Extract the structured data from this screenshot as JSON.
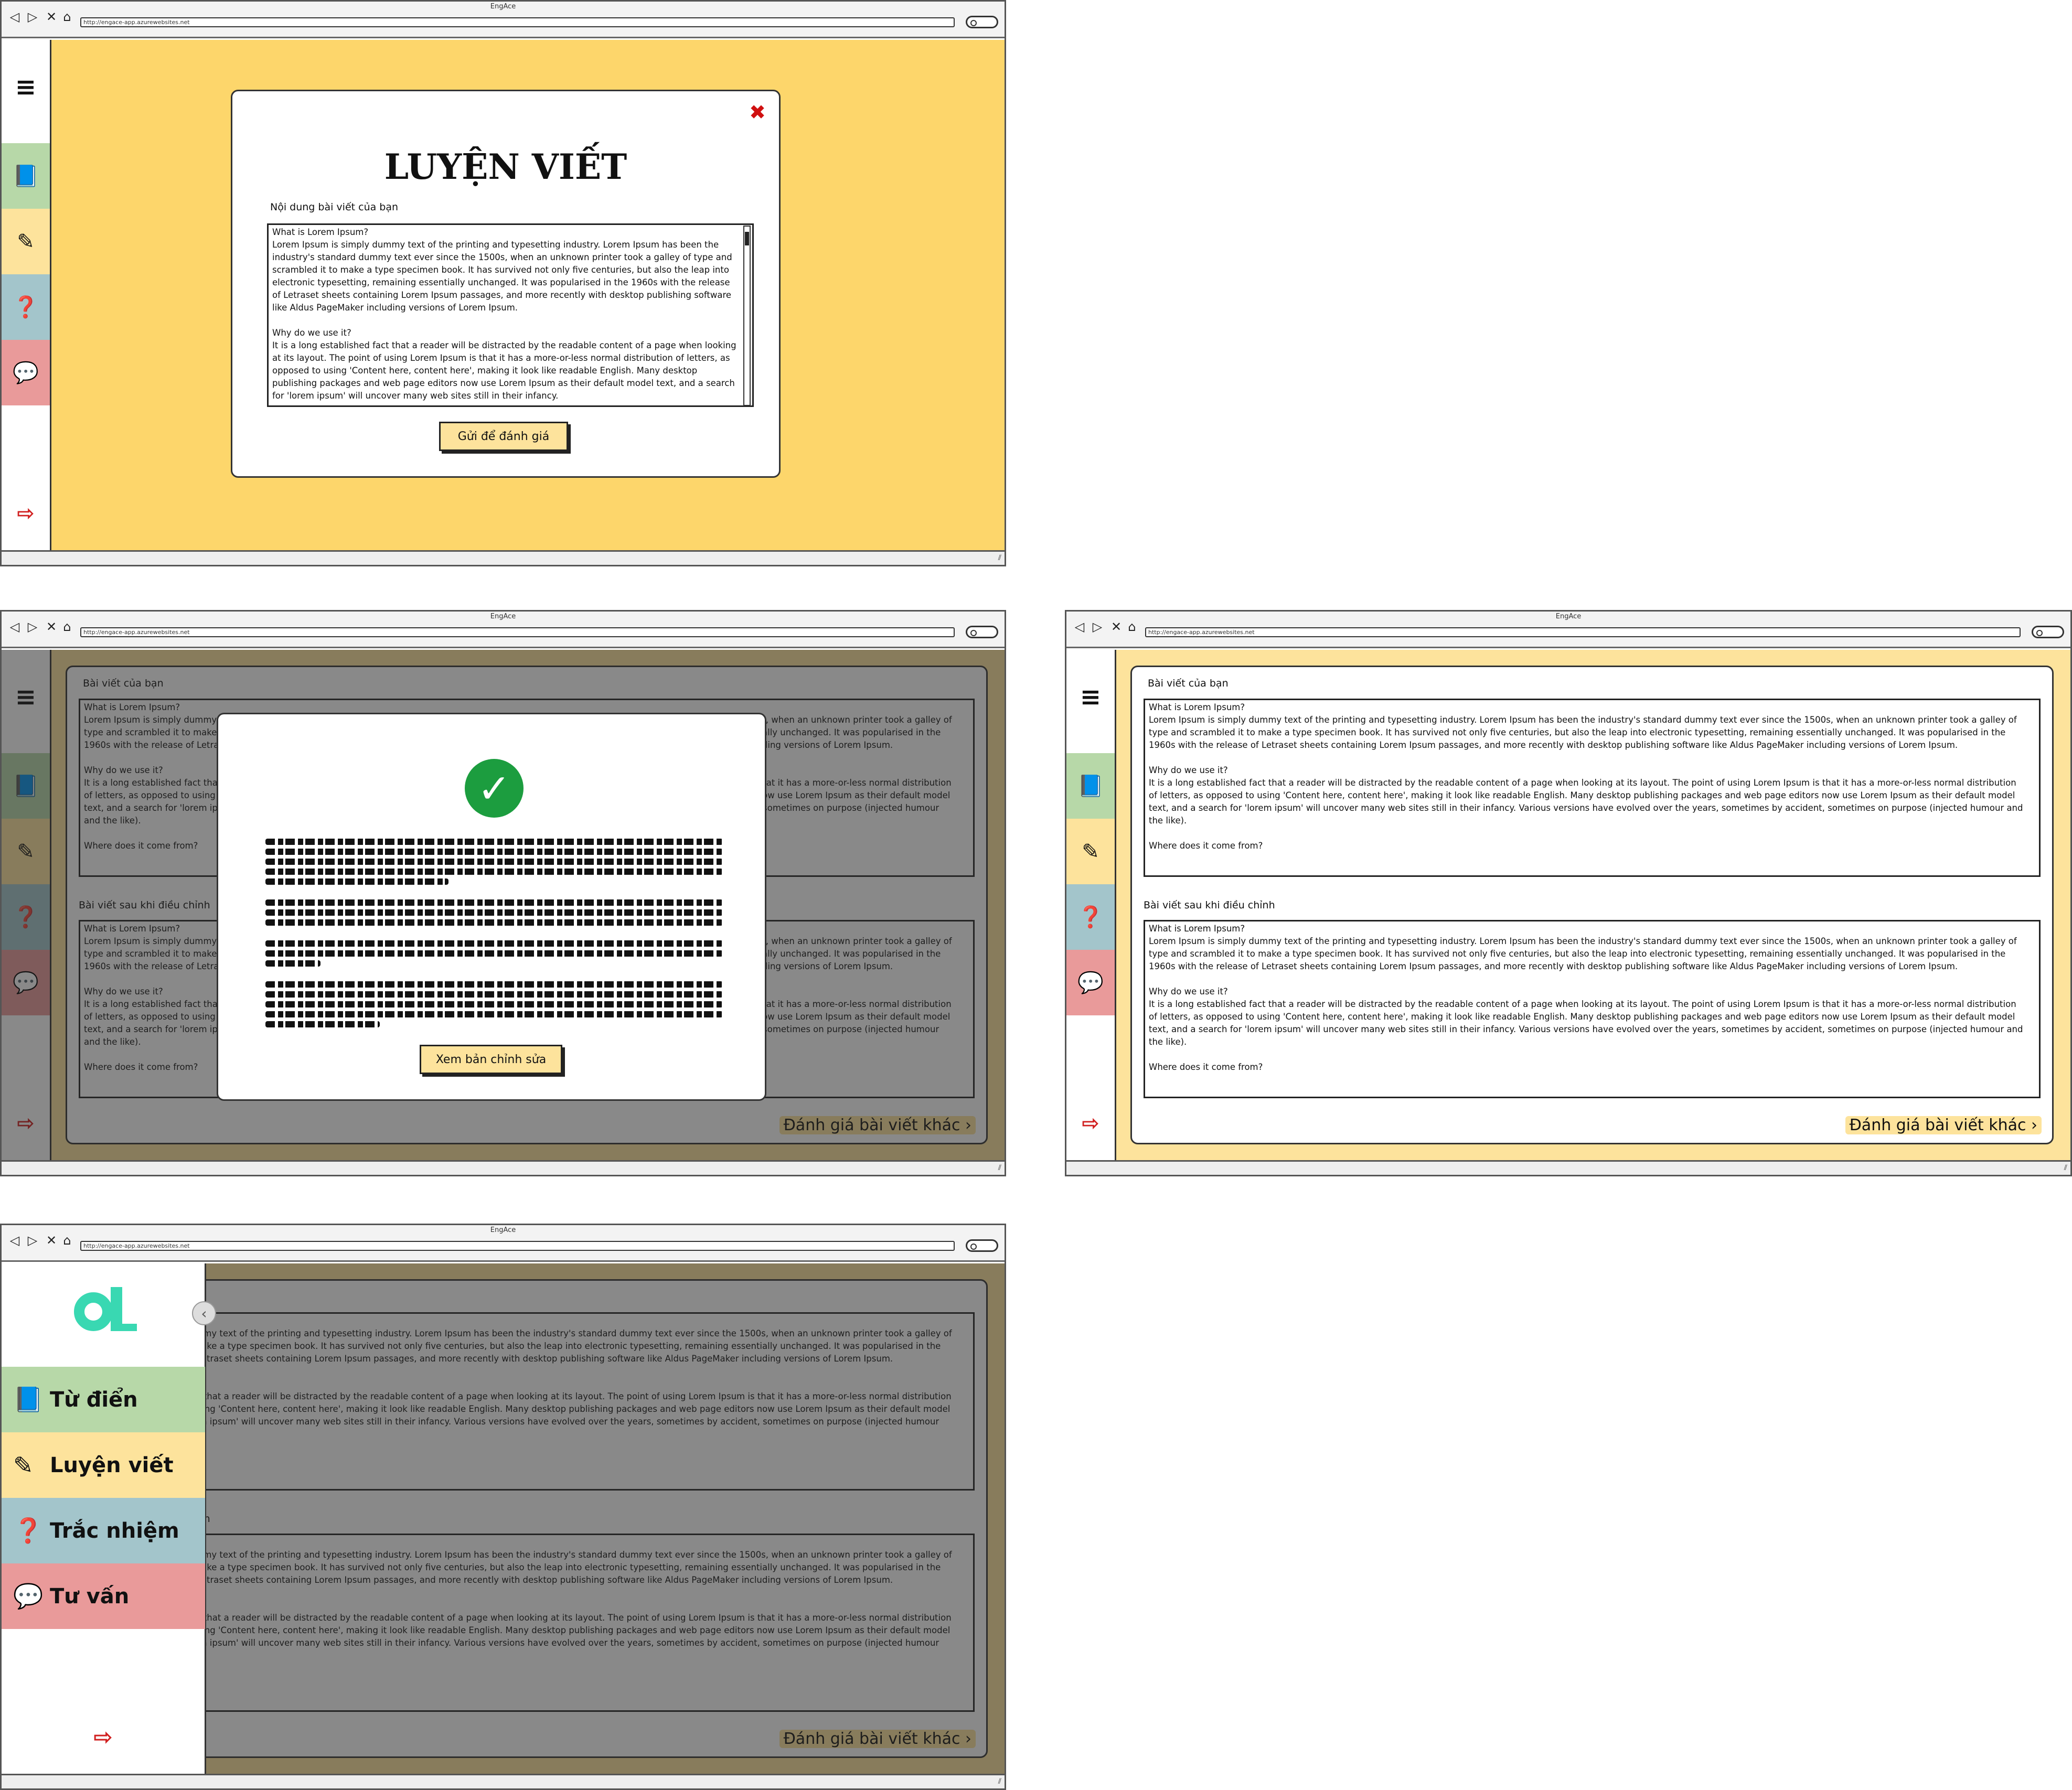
{
  "browser": {
    "title": "EngAce",
    "url": "http://engace-app.azurewebsites.net"
  },
  "sidebar": {
    "menu_icon": "hamburger-menu-icon",
    "items": [
      {
        "icon": "book-icon",
        "label": "Từ điển",
        "color": "#b7d8a8"
      },
      {
        "icon": "pencil-icon",
        "label": "Luyện viết",
        "color": "#fde39c"
      },
      {
        "icon": "question-icon",
        "label": "Trắc nhiệm",
        "color": "#a3c5cb"
      },
      {
        "icon": "chat-icon",
        "label": "Tư vấn",
        "color": "#e99a9a"
      }
    ],
    "logout_icon": "sign-out-icon",
    "collapse_glyph": "‹"
  },
  "submit_screen": {
    "heading": "LUYỆN VIẾT",
    "content_label": "Nội dung bài viết của bạn",
    "essay": "What is Lorem Ipsum?\nLorem Ipsum is simply dummy text of the printing and typesetting industry. Lorem Ipsum has been the industry's standard dummy text ever since the 1500s, when an unknown printer took a galley of type and scrambled it to make a type specimen book. It has survived not only five centuries, but also the leap into electronic typesetting, remaining essentially unchanged. It was popularised in the 1960s with the release of Letraset sheets containing Lorem Ipsum passages, and more recently with desktop publishing software like Aldus PageMaker including versions of Lorem Ipsum.\n\nWhy do we use it?\nIt is a long established fact that a reader will be distracted by the readable content of a page when looking at its layout. The point of using Lorem Ipsum is that it has a more-or-less normal distribution of letters, as opposed to using 'Content here, content here', making it look like readable English. Many desktop publishing packages and web page editors now use Lorem Ipsum as their default model text, and a search for 'lorem ipsum' will uncover many web sites still in their infancy.",
    "close_glyph": "✖",
    "submit_label": "Gửi để đánh giá"
  },
  "result_screen": {
    "your_essay_label": "Bài viết của bạn",
    "revised_label": "Bài viết sau khi điều chỉnh",
    "essay": "What is Lorem Ipsum?\nLorem Ipsum is simply dummy text of the printing and typesetting industry. Lorem Ipsum has been the industry's standard dummy text ever since the 1500s, when an unknown printer took a galley of type and scrambled it to make a type specimen book. It has survived not only five centuries, but also the leap into electronic typesetting, remaining essentially unchanged. It was popularised in the 1960s with the release of Letraset sheets containing Lorem Ipsum passages, and more recently with desktop publishing software like Aldus PageMaker including versions of Lorem Ipsum.\n\nWhy do we use it?\nIt is a long established fact that a reader will be distracted by the readable content of a page when looking at its layout. The point of using Lorem Ipsum is that it has a more-or-less normal distribution of letters, as opposed to using 'Content here, content here', making it look like readable English. Many desktop publishing packages and web page editors now use Lorem Ipsum as their default model text, and a search for 'lorem ipsum' will uncover many web sites still in their infancy. Various versions have evolved over the years, sometimes by accident, sometimes on purpose (injected humour and the like).\n\nWhere does it come from?",
    "other_link": "Đánh giá bài viết khác ›"
  },
  "success_modal": {
    "icon": "check-circle-icon",
    "view_revision_label": "Xem bản chỉnh sửa"
  },
  "drawer": {
    "logo": "al-logo"
  }
}
